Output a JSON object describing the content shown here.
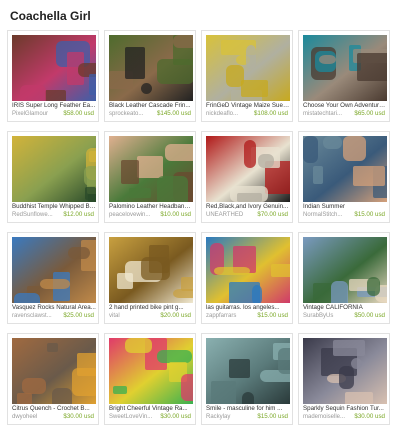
{
  "page": {
    "title": "Coachella Girl"
  },
  "items": [
    {
      "title": "IRIS Super Long Feather Ea...",
      "shop": "PixelGlamour",
      "price": "$58.00 usd",
      "icon": "feather-earrings-image",
      "colors": [
        "#6b3a2a",
        "#3d5fa8",
        "#c23a6a"
      ]
    },
    {
      "title": "Black Leather Cascade Frin...",
      "shop": "sprockeato...",
      "price": "$145.00 usd",
      "icon": "leather-fringe-bag-image",
      "colors": [
        "#4e6b2d",
        "#222222",
        "#8a6a4a"
      ]
    },
    {
      "title": "FrinGeD Vintage Maize Sued...",
      "shop": "nickdeaflo...",
      "price": "$108.00 usd",
      "icon": "suede-fringe-boots-image",
      "colors": [
        "#d8c23a",
        "#c7a91e",
        "#b0b0a0"
      ]
    },
    {
      "title": "Choose Your Own Adventure ...",
      "shop": "mistatechtari...",
      "price": "$65.00 usd",
      "icon": "turquoise-ring-image",
      "colors": [
        "#1b8a9c",
        "#4a3a30",
        "#9a8a7a"
      ]
    },
    {
      "title": "Buddhist Temple Whipped Bo...",
      "shop": "RedSunflowe...",
      "price": "$12.00 usd",
      "icon": "incense-sticks-image",
      "colors": [
        "#d2b33a",
        "#2a4a2a",
        "#8aa050"
      ]
    },
    {
      "title": "Palomino Leather Headband ...",
      "shop": "peacelovewin...",
      "price": "$10.00 usd",
      "icon": "smiling-girl-headband-image",
      "colors": [
        "#e0b090",
        "#6a4a30",
        "#4a7a3a"
      ]
    },
    {
      "title": "Red,Black,and Ivory Genuin...",
      "shop": "UNEARTHED",
      "price": "$70.00 usd",
      "icon": "red-cuff-bracelet-image",
      "colors": [
        "#b01818",
        "#1a1a1a",
        "#e8e2d0"
      ]
    },
    {
      "title": "Indian Summer",
      "shop": "NormalStitch...",
      "price": "$15.00 usd",
      "icon": "tattooed-girl-necklace-image",
      "colors": [
        "#6a8a9a",
        "#d4a07a",
        "#3a5a7a"
      ]
    },
    {
      "title": "Vasquez Rocks Natural Area...",
      "shop": "ravensclawst...",
      "price": "$25.00 usd",
      "icon": "desert-rocks-image",
      "colors": [
        "#3a7ac0",
        "#c08a4a",
        "#7a5a3a"
      ]
    },
    {
      "title": "2 hand printed bike pint g...",
      "shop": "vital",
      "price": "$20.00 usd",
      "icon": "pint-glasses-image",
      "colors": [
        "#c8a040",
        "#f0e8d0",
        "#7a5a20"
      ]
    },
    {
      "title": "las guitarras. los angeles...",
      "shop": "zappfarrars",
      "price": "$15.00 usd",
      "icon": "colorful-guitars-image",
      "colors": [
        "#2a7ac0",
        "#d03a6a",
        "#e0c030"
      ]
    },
    {
      "title": "Vintage CALIFORNIA",
      "shop": "SurabByUs",
      "price": "$50.00 usd",
      "icon": "california-dress-image",
      "colors": [
        "#7a9ac0",
        "#e8d8c0",
        "#3a6a3a"
      ]
    },
    {
      "title": "Citrus Quench - Crochet B...",
      "shop": "dwyoheel",
      "price": "$30.00 usd",
      "icon": "crochet-barefoot-sandals-image",
      "colors": [
        "#a06a40",
        "#e0a030",
        "#6a5a4a"
      ]
    },
    {
      "title": "Bright Cheerful Vintage Ra...",
      "shop": "SweetLoveVin...",
      "price": "$30.00 usd",
      "icon": "colorful-yarn-fringe-image",
      "colors": [
        "#e03a6a",
        "#3ab050",
        "#e0d030"
      ]
    },
    {
      "title": "Smile - masculine for him ...",
      "shop": "Rackylay",
      "price": "$15.00 usd",
      "icon": "bare-tree-branches-image",
      "colors": [
        "#8ab0b0",
        "#2a3a3a",
        "#5a7a7a"
      ]
    },
    {
      "title": "Sparkly Sequin Fashion Tur...",
      "shop": "mademoiselle...",
      "price": "$30.00 usd",
      "icon": "sequin-turban-image",
      "colors": [
        "#3a3a4a",
        "#d8c0b0",
        "#8a8a9a"
      ]
    }
  ]
}
